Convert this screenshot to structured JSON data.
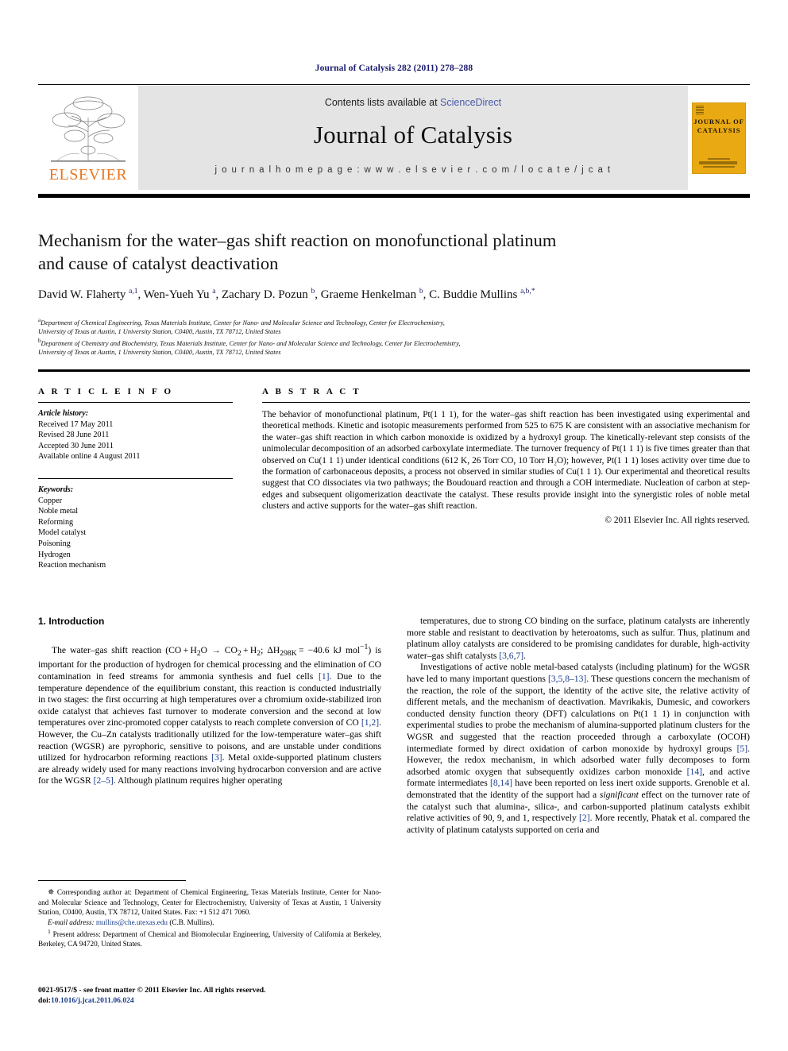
{
  "running_head": "Journal of Catalysis 282 (2011) 278–288",
  "masthead": {
    "contents_prefix": "Contents lists available at ",
    "contents_link": "ScienceDirect",
    "journal_name": "Journal of Catalysis",
    "homepage": "j o u r n a l   h o m e p a g e :   w w w . e l s e v i e r . c o m / l o c a t e / j c a t",
    "publisher_logo_text": "ELSEVIER",
    "cover_title_line1": "JOURNAL OF",
    "cover_title_line2": "CATALYSIS",
    "cover_color": "#E9A913",
    "link_color": "#4a5ba8"
  },
  "article": {
    "title_line1": "Mechanism for the water–gas shift reaction on monofunctional platinum",
    "title_line2": "and cause of catalyst deactivation",
    "authors_html": "David W. Flaherty <sup>a,1</sup>, Wen-Yueh Yu <sup>a</sup>, Zachary D. Pozun <sup>b</sup>, Graeme Henkelman <sup>b</sup>, C. Buddie Mullins <sup>a,b,</sup><sup>*</sup>",
    "affiliation_a_line1": "Department of Chemical Engineering, Texas Materials Institute, Center for Nano- and Molecular Science and Technology, Center for Electrochemistry,",
    "affiliation_a_line2": "University of Texas at Austin, 1 University Station, C0400, Austin, TX 78712, United States",
    "affiliation_b_line1": "Department of Chemistry and Biochemistry, Texas Materials Institute, Center for Nano- and Molecular Science and Technology, Center for Electrochemistry,",
    "affiliation_b_line2": "University of Texas at Austin, 1 University Station, C0400, Austin, TX 78712, United States"
  },
  "article_info": {
    "heading": "A R T I C L E    I N F O",
    "history_label": "Article history:",
    "history": [
      "Received 17 May 2011",
      "Revised 28 June 2011",
      "Accepted 30 June 2011",
      "Available online 4 August 2011"
    ],
    "keywords_label": "Keywords:",
    "keywords": [
      "Copper",
      "Noble metal",
      "Reforming",
      "Model catalyst",
      "Poisoning",
      "Hydrogen",
      "Reaction mechanism"
    ]
  },
  "abstract": {
    "heading": "A B S T R A C T",
    "text": "The behavior of monofunctional platinum, Pt(1 1 1), for the water–gas shift reaction has been investigated using experimental and theoretical methods. Kinetic and isotopic measurements performed from 525 to 675 K are consistent with an associative mechanism for the water–gas shift reaction in which carbon monoxide is oxidized by a hydroxyl group. The kinetically-relevant step consists of the unimolecular decomposition of an adsorbed carboxylate intermediate. The turnover frequency of Pt(1 1 1) is five times greater than that observed on Cu(1 1 1) under identical conditions (612 K, 26 Torr CO, 10 Torr H₂O); however, Pt(1 1 1) loses activity over time due to the formation of carbonaceous deposits, a process not observed in similar studies of Cu(1 1 1). Our experimental and theoretical results suggest that CO dissociates via two pathways; the Boudouard reaction and through a COH intermediate. Nucleation of carbon at step-edges and subsequent oligomerization deactivate the catalyst. These results provide insight into the synergistic roles of noble metal clusters and active supports for the water–gas shift reaction.",
    "copyright": "© 2011 Elsevier Inc. All rights reserved."
  },
  "body": {
    "section_heading": "1. Introduction",
    "left_paragraph_1_html": "The water–gas shift reaction (CO + H<sub>2</sub>O → CO<sub>2</sub> + H<sub>2</sub>; ΔH<sub>298K</sub> = −40.6 kJ mol<sup>−1</sup>) is important for the production of hydrogen for chemical processing and the elimination of CO contamination in feed streams for ammonia synthesis and fuel cells <span class=\"ref\">[1]</span>. Due to the temperature dependence of the equilibrium constant, this reaction is conducted industrially in two stages: the first occurring at high temperatures over a chromium oxide-stabilized iron oxide catalyst that achieves fast turnover to moderate conversion and the second at low temperatures over zinc-promoted copper catalysts to reach complete conversion of CO <span class=\"ref\">[1,2]</span>. However, the Cu–Zn catalysts traditionally utilized for the low-temperature water–gas shift reaction (WGSR) are pyrophoric, sensitive to poisons, and are unstable under conditions utilized for hydrocarbon reforming reactions <span class=\"ref\">[3]</span>. Metal oxide-supported platinum clusters are already widely used for many reactions involving hydrocarbon conversion and are active for the WGSR <span class=\"ref\">[2–5]</span>. Although platinum requires higher operating",
    "right_paragraph_1_html": "temperatures, due to strong CO binding on the surface, platinum catalysts are inherently more stable and resistant to deactivation by heteroatoms, such as sulfur. Thus, platinum and platinum alloy catalysts are considered to be promising candidates for durable, high-activity water–gas shift catalysts <span class=\"ref\">[3,6,7]</span>.",
    "right_paragraph_2_html": "Investigations of active noble metal-based catalysts (including platinum) for the WGSR have led to many important questions <span class=\"ref\">[3,5,8–13]</span>. These questions concern the mechanism of the reaction, the role of the support, the identity of the active site, the relative activity of different metals, and the mechanism of deactivation. Mavrikakis, Dumesic, and coworkers conducted density function theory (DFT) calculations on Pt(1 1 1) in conjunction with experimental studies to probe the mechanism of alumina-supported platinum clusters for the WGSR and suggested that the reaction proceeded through a carboxylate (OCOH) intermediate formed by direct oxidation of carbon monoxide by hydroxyl groups <span class=\"ref\">[5]</span>. However, the redox mechanism, in which adsorbed water fully decomposes to form adsorbed atomic oxygen that subsequently oxidizes carbon monoxide <span class=\"ref\">[14]</span>, and active formate intermediates <span class=\"ref\">[8,14]</span> have been reported on less inert oxide supports. Grenoble et al. demonstrated that the identity of the support had a <i>significant</i> effect on the turnover rate of the catalyst such that alumina-, silica-, and carbon-supported platinum catalysts exhibit relative activities of 90, 9, and 1, respectively <span class=\"ref\">[2]</span>. More recently, Phatak et al. compared the activity of platinum catalysts supported on ceria and"
  },
  "footnotes": {
    "corresponding_html": "<span style=\"font-size:10px\">&#10037;</span> Corresponding author at: Department of Chemical Engineering, Texas Materials Institute, Center for Nano- and Molecular Science and Technology, Center for Electrochemistry, University of Texas at Austin, 1 University Station, C0400, Austin, TX 78712, United States. Fax: +1 512 471 7060.",
    "email_html": "<span class=\"em\">E-mail address:</span> <a href=\"#\">mullins@che.utexas.edu</a> (C.B. Mullins).",
    "present_address_html": "<sup>1</sup> Present address: Department of Chemical and Biomolecular Engineering, University of California at Berkeley, Berkeley, CA 94720, United States."
  },
  "imprint": {
    "issn_line": "0021-9517/$ - see front matter © 2011 Elsevier Inc. All rights reserved.",
    "doi_prefix": "doi:",
    "doi": "10.1016/j.jcat.2011.06.024"
  }
}
